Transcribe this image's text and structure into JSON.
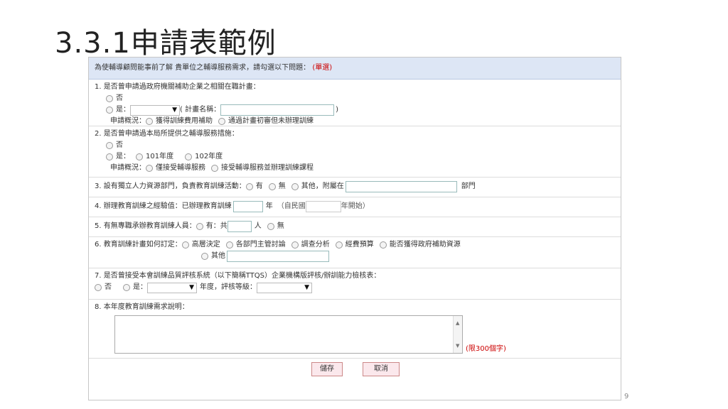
{
  "slide": {
    "title": "3.3.1申請表範例",
    "page_number": "9"
  },
  "form": {
    "header": {
      "text": "為使輔導顧問能事前了解 貴單位之輔導服務需求，請勾選以下問題：",
      "note": "(單選)"
    },
    "q1": {
      "question": "1. 是否曾申請過政府機關補助企業之相關在職計畫：",
      "no": "否",
      "yes": "是：",
      "plan_name_label": "( 計畫名稱：",
      "plan_close": ")",
      "status_label": "申請概況：",
      "status_opt1": "獲得訓練費用補助",
      "status_opt2": "通過計畫初審但未辦理訓練"
    },
    "q2": {
      "question": "2. 是否曾申請過本局所提供之輔導服務措施：",
      "no": "否",
      "yes": "是：",
      "year1": "101年度",
      "year2": "102年度",
      "status_label": "申請概況：",
      "status_opt1": "僅接受輔導服務",
      "status_opt2": "接受輔導服務並辦理訓練課程"
    },
    "q3": {
      "question": "3. 設有獨立人力資源部門，負責教育訓練活動：",
      "yes": "有",
      "no": "無",
      "other": "其他，附屬在",
      "dept": "部門"
    },
    "q4": {
      "question": "4. 辦理教育訓練之經驗值：已辦理教育訓練",
      "year_unit": "年",
      "since_open": "（自民國",
      "since_close": "年開始）"
    },
    "q5": {
      "question": "5. 有無專職承辦教育訓練人員：",
      "yes": "有：共",
      "unit": "人",
      "no": "無"
    },
    "q6": {
      "question": "6. 教育訓練計畫如何訂定：",
      "opt1": "高層決定",
      "opt2": "各部門主管討論",
      "opt3": "調查分析",
      "opt4": "經費預算",
      "opt5": "能否獲得政府補助資源",
      "opt6": "其他"
    },
    "q7": {
      "question": "7. 是否曾接受本會訓練品質評核系統（以下簡稱TTQS）企業機構版評核/辦訓能力檢核表：",
      "no": "否",
      "yes": "是：",
      "year_label": "年度，評核等級："
    },
    "q8": {
      "question": "8. 本年度教育訓練需求說明：",
      "limit": "(限300個字)"
    },
    "buttons": {
      "save": "儲存",
      "cancel": "取消"
    }
  }
}
